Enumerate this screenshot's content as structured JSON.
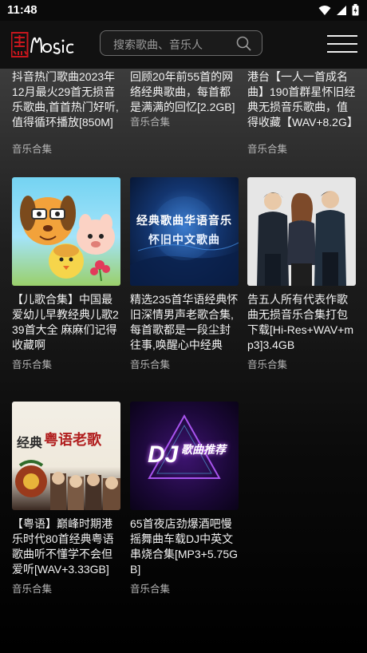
{
  "status": {
    "time": "11:48"
  },
  "header": {
    "search_placeholder": "搜索歌曲、音乐人"
  },
  "top_row": [
    {
      "title": "抖音热门歌曲2023年12月最火29首无损音乐歌曲,首首热门好听,值得循环播放[850M]",
      "category": "音乐合集"
    },
    {
      "title": "回顾20年前55首的网络经典歌曲，每首都是满满的回忆[2.2GB]",
      "category": "音乐合集"
    },
    {
      "title": "港台【一人一首成名曲】190首群星怀旧经典无损音乐歌曲，值得收藏【WAV+8.2G】",
      "category": "音乐合集"
    }
  ],
  "cards": [
    {
      "title": "【儿歌合集】中国最爱幼儿早教经典儿歌239首大全 麻麻们记得收藏啊",
      "category": "音乐合集",
      "thumb_icon": "cartoon-kids-thumbnail"
    },
    {
      "title": "精选235首华语经典怀旧深情男声老歌合集,每首歌都是一段尘封往事,唤醒心中经典",
      "category": "音乐合集",
      "thumb_icon": "classic-songs-thumbnail",
      "thumb_text_1": "经典歌曲华语音乐",
      "thumb_text_2": "怀旧中文歌曲"
    },
    {
      "title": "告五人所有代表作歌曲无损音乐合集打包下载[Hi-Res+WAV+mp3]3.4GB",
      "category": "音乐合集",
      "thumb_icon": "band-photo-thumbnail"
    },
    {
      "title": "【粤语】巅峰时期港乐时代80首经典粤语歌曲听不懂学不会但爱听[WAV+3.33GB]",
      "category": "音乐合集",
      "thumb_icon": "cantonese-thumbnail",
      "thumb_text_1": "粤语老歌",
      "thumb_text_2": "经典"
    },
    {
      "title": "65首夜店劲爆酒吧慢摇舞曲车载DJ中英文串烧合集[MP3+5.75GB]",
      "category": "音乐合集",
      "thumb_icon": "dj-thumbnail",
      "thumb_text_1": "DJ",
      "thumb_text_2": "歌曲推荐"
    }
  ]
}
